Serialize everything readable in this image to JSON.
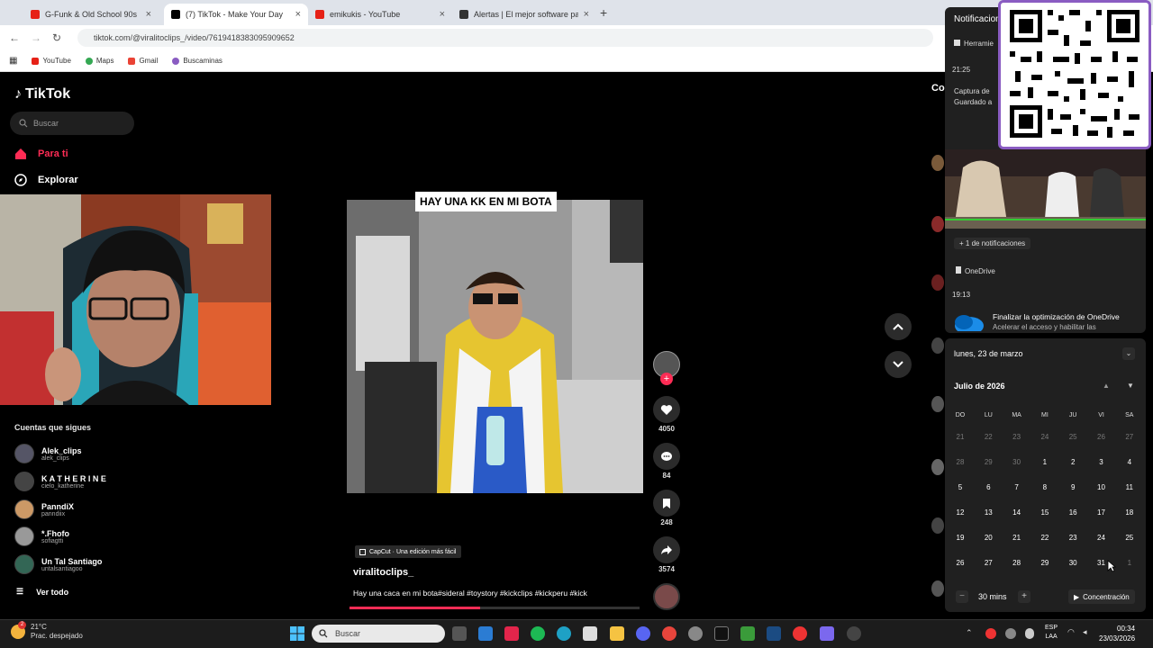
{
  "browser": {
    "tabs": [
      {
        "title": "G-Funk & Old School 90s 🎙️ Sr",
        "color": "#e62117"
      },
      {
        "title": "(7) TikTok - Make Your Day",
        "color": "#000000"
      },
      {
        "title": "emikukis - YouTube",
        "color": "#e62117"
      },
      {
        "title": "Alertas | El mejor software para",
        "color": "#333333"
      }
    ],
    "url": "tiktok.com/@viralitoclips_/video/7619418383095909652",
    "bookmarks": [
      {
        "label": "YouTube",
        "color": "#e62117"
      },
      {
        "label": "Maps",
        "color": "#34a853"
      },
      {
        "label": "Gmail",
        "color": "#ea4335"
      },
      {
        "label": "Buscaminas",
        "color": "#8a5cc2"
      }
    ]
  },
  "tiktok": {
    "logo": "TikTok",
    "search_placeholder": "Buscar",
    "nav": {
      "for_you": "Para ti",
      "explore": "Explorar"
    },
    "following_title": "Cuentas que sigues",
    "following": [
      {
        "name": "Alek_clips",
        "handle": "alek_clips",
        "color": "#556"
      },
      {
        "name": "K A T H E R I N E",
        "handle": "cielo_katherine",
        "color": "#444"
      },
      {
        "name": "PanndiX",
        "handle": "panndiix",
        "color": "#c96"
      },
      {
        "name": "*.Fhofo",
        "handle": "sofiagtti",
        "color": "#999"
      },
      {
        "name": "Un Tal Santiago",
        "handle": "untalsantiagoo",
        "color": "#365"
      }
    ],
    "see_all": "Ver todo",
    "video": {
      "caption": "HAY UNA KK EN MI BOTA",
      "capcut": "CapCut · Una edición más fácil",
      "username": "viralitoclips_",
      "description": "Hay una caca en mi bota#sideral #toystory #kickclips #kickperu #kick",
      "progress": 0.45,
      "likes": "4050",
      "comments": "84",
      "saves": "248",
      "shares": "3574"
    },
    "right_partial": "Co"
  },
  "notifications": {
    "title": "Notificacion",
    "app_label": "Herramie",
    "time1": "21:25",
    "capture_line1": "Captura de",
    "capture_line2": "Guardado a",
    "more": "+ 1 de notificaciones",
    "onedrive": "OneDrive",
    "time2": "19:13",
    "onedrive_title": "Finalizar la optimización de OneDrive",
    "onedrive_body": "Acelerar el acceso y habilitar las"
  },
  "calendar": {
    "date_header": "lunes, 23 de marzo",
    "month": "Julio de 2026",
    "weekdays": [
      "DO",
      "LU",
      "MA",
      "MI",
      "JU",
      "VI",
      "SA"
    ],
    "weeks": [
      [
        "21",
        "22",
        "23",
        "24",
        "25",
        "26",
        "27"
      ],
      [
        "28",
        "29",
        "30",
        "1",
        "2",
        "3",
        "4"
      ],
      [
        "5",
        "6",
        "7",
        "8",
        "9",
        "10",
        "11"
      ],
      [
        "12",
        "13",
        "14",
        "15",
        "16",
        "17",
        "18"
      ],
      [
        "19",
        "20",
        "21",
        "22",
        "23",
        "24",
        "25"
      ],
      [
        "26",
        "27",
        "28",
        "29",
        "30",
        "31",
        "1"
      ]
    ],
    "focus_minutes": "30 mins",
    "focus_button": "Concentración"
  },
  "taskbar": {
    "temp": "21°C",
    "weather": "Prac. despejado",
    "weather_badge": "2",
    "search": "Buscar",
    "lang1": "ESP",
    "lang2": "LAA",
    "time": "00:34",
    "date": "23/03/2026"
  }
}
